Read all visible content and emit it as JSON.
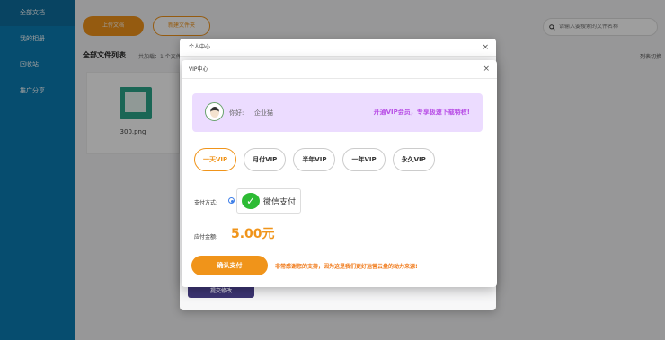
{
  "sidebar": {
    "items": [
      {
        "label": "全部文档"
      },
      {
        "label": "我的相册"
      },
      {
        "label": "回收站"
      },
      {
        "label": "推广分享"
      }
    ]
  },
  "toolbar": {
    "upload_label": "上传文档",
    "new_folder_label": "新建文件夹",
    "search_placeholder": "请输入要搜索的文件名称"
  },
  "list": {
    "title": "全部文件列表",
    "subtitle": "共加载：1 个文件",
    "view_mode": "列表切换",
    "files": [
      {
        "name": "300.png"
      }
    ]
  },
  "personal_dialog": {
    "title": "个人中心",
    "close": "×",
    "submit_label": "提交修改"
  },
  "vip_dialog": {
    "title": "VIP中心",
    "close": "×",
    "greeting": "你好:",
    "username": "企业猫",
    "promo": "开通VIP会员，专享极速下载特权!",
    "plans": [
      {
        "label": "一天VIP",
        "selected": true
      },
      {
        "label": "月付VIP",
        "selected": false
      },
      {
        "label": "半年VIP",
        "selected": false
      },
      {
        "label": "一年VIP",
        "selected": false
      },
      {
        "label": "永久VIP",
        "selected": false
      }
    ],
    "payment_label": "支付方式:",
    "payment_method": "微信支付",
    "amount_label": "应付金额:",
    "amount": "5.00元",
    "confirm_label": "确认支付",
    "thanks_text": "非常感谢您的支持，因为这是我们更好运营云盘的动力来源!"
  },
  "colors": {
    "sidebar": "#0b7db3",
    "accent": "#f0941a",
    "promo": "#b84ee6",
    "wechat": "#2dbb34"
  }
}
